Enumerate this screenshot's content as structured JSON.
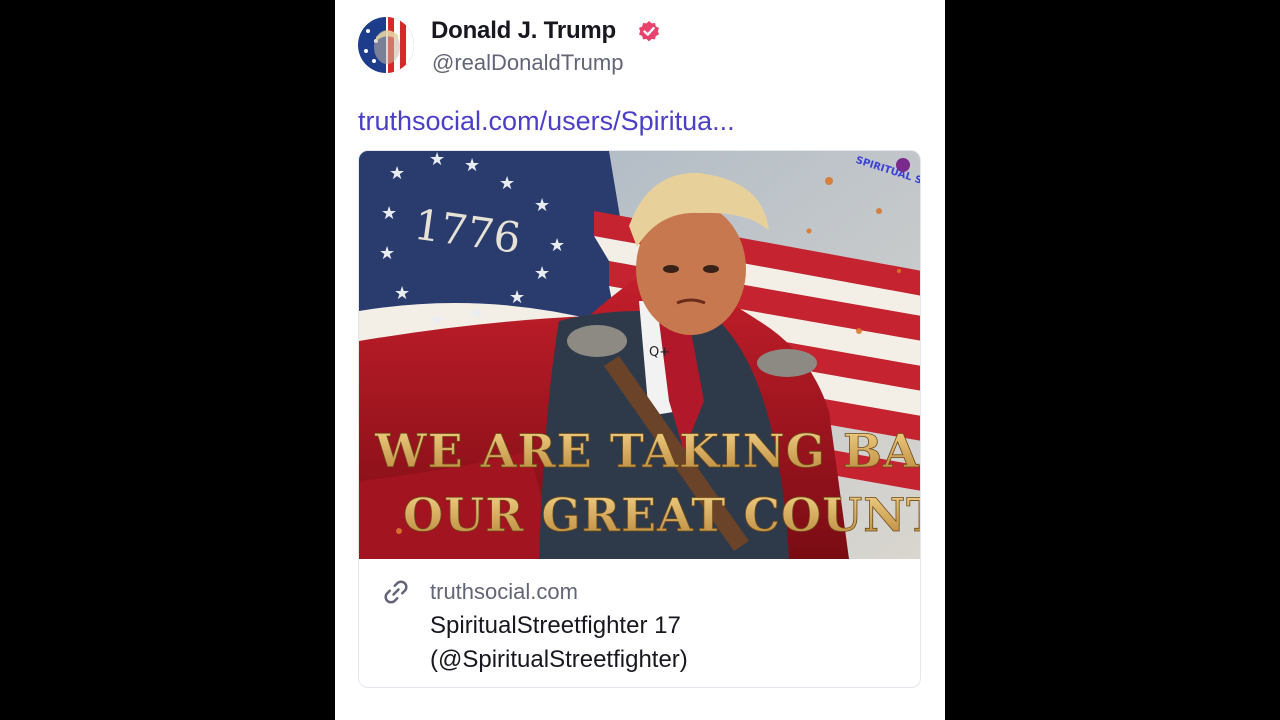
{
  "post": {
    "author": {
      "display_name": "Donald J. Trump",
      "handle": "@realDonaldTrump",
      "verified": true,
      "verified_icon": "verified-badge-icon"
    },
    "link_text": "truthsocial.com/users/Spiritua...",
    "link_preview": {
      "image": {
        "year_text": "1776",
        "headline_line1": "WE ARE TAKING BACK",
        "headline_line2": "OUR GREAT COUNTRY",
        "watermark": "SPIRITUAL STREETFIGHTER",
        "tie_badge": "Q+"
      },
      "icon": "link-icon",
      "domain": "truthsocial.com",
      "title_line1": "SpiritualStreetfighter 17",
      "title_line2": "(@SpiritualStreetfighter)"
    }
  },
  "colors": {
    "link": "#4c3fc7",
    "verified": "#e8426d",
    "background": "#000000",
    "card": "#ffffff"
  }
}
